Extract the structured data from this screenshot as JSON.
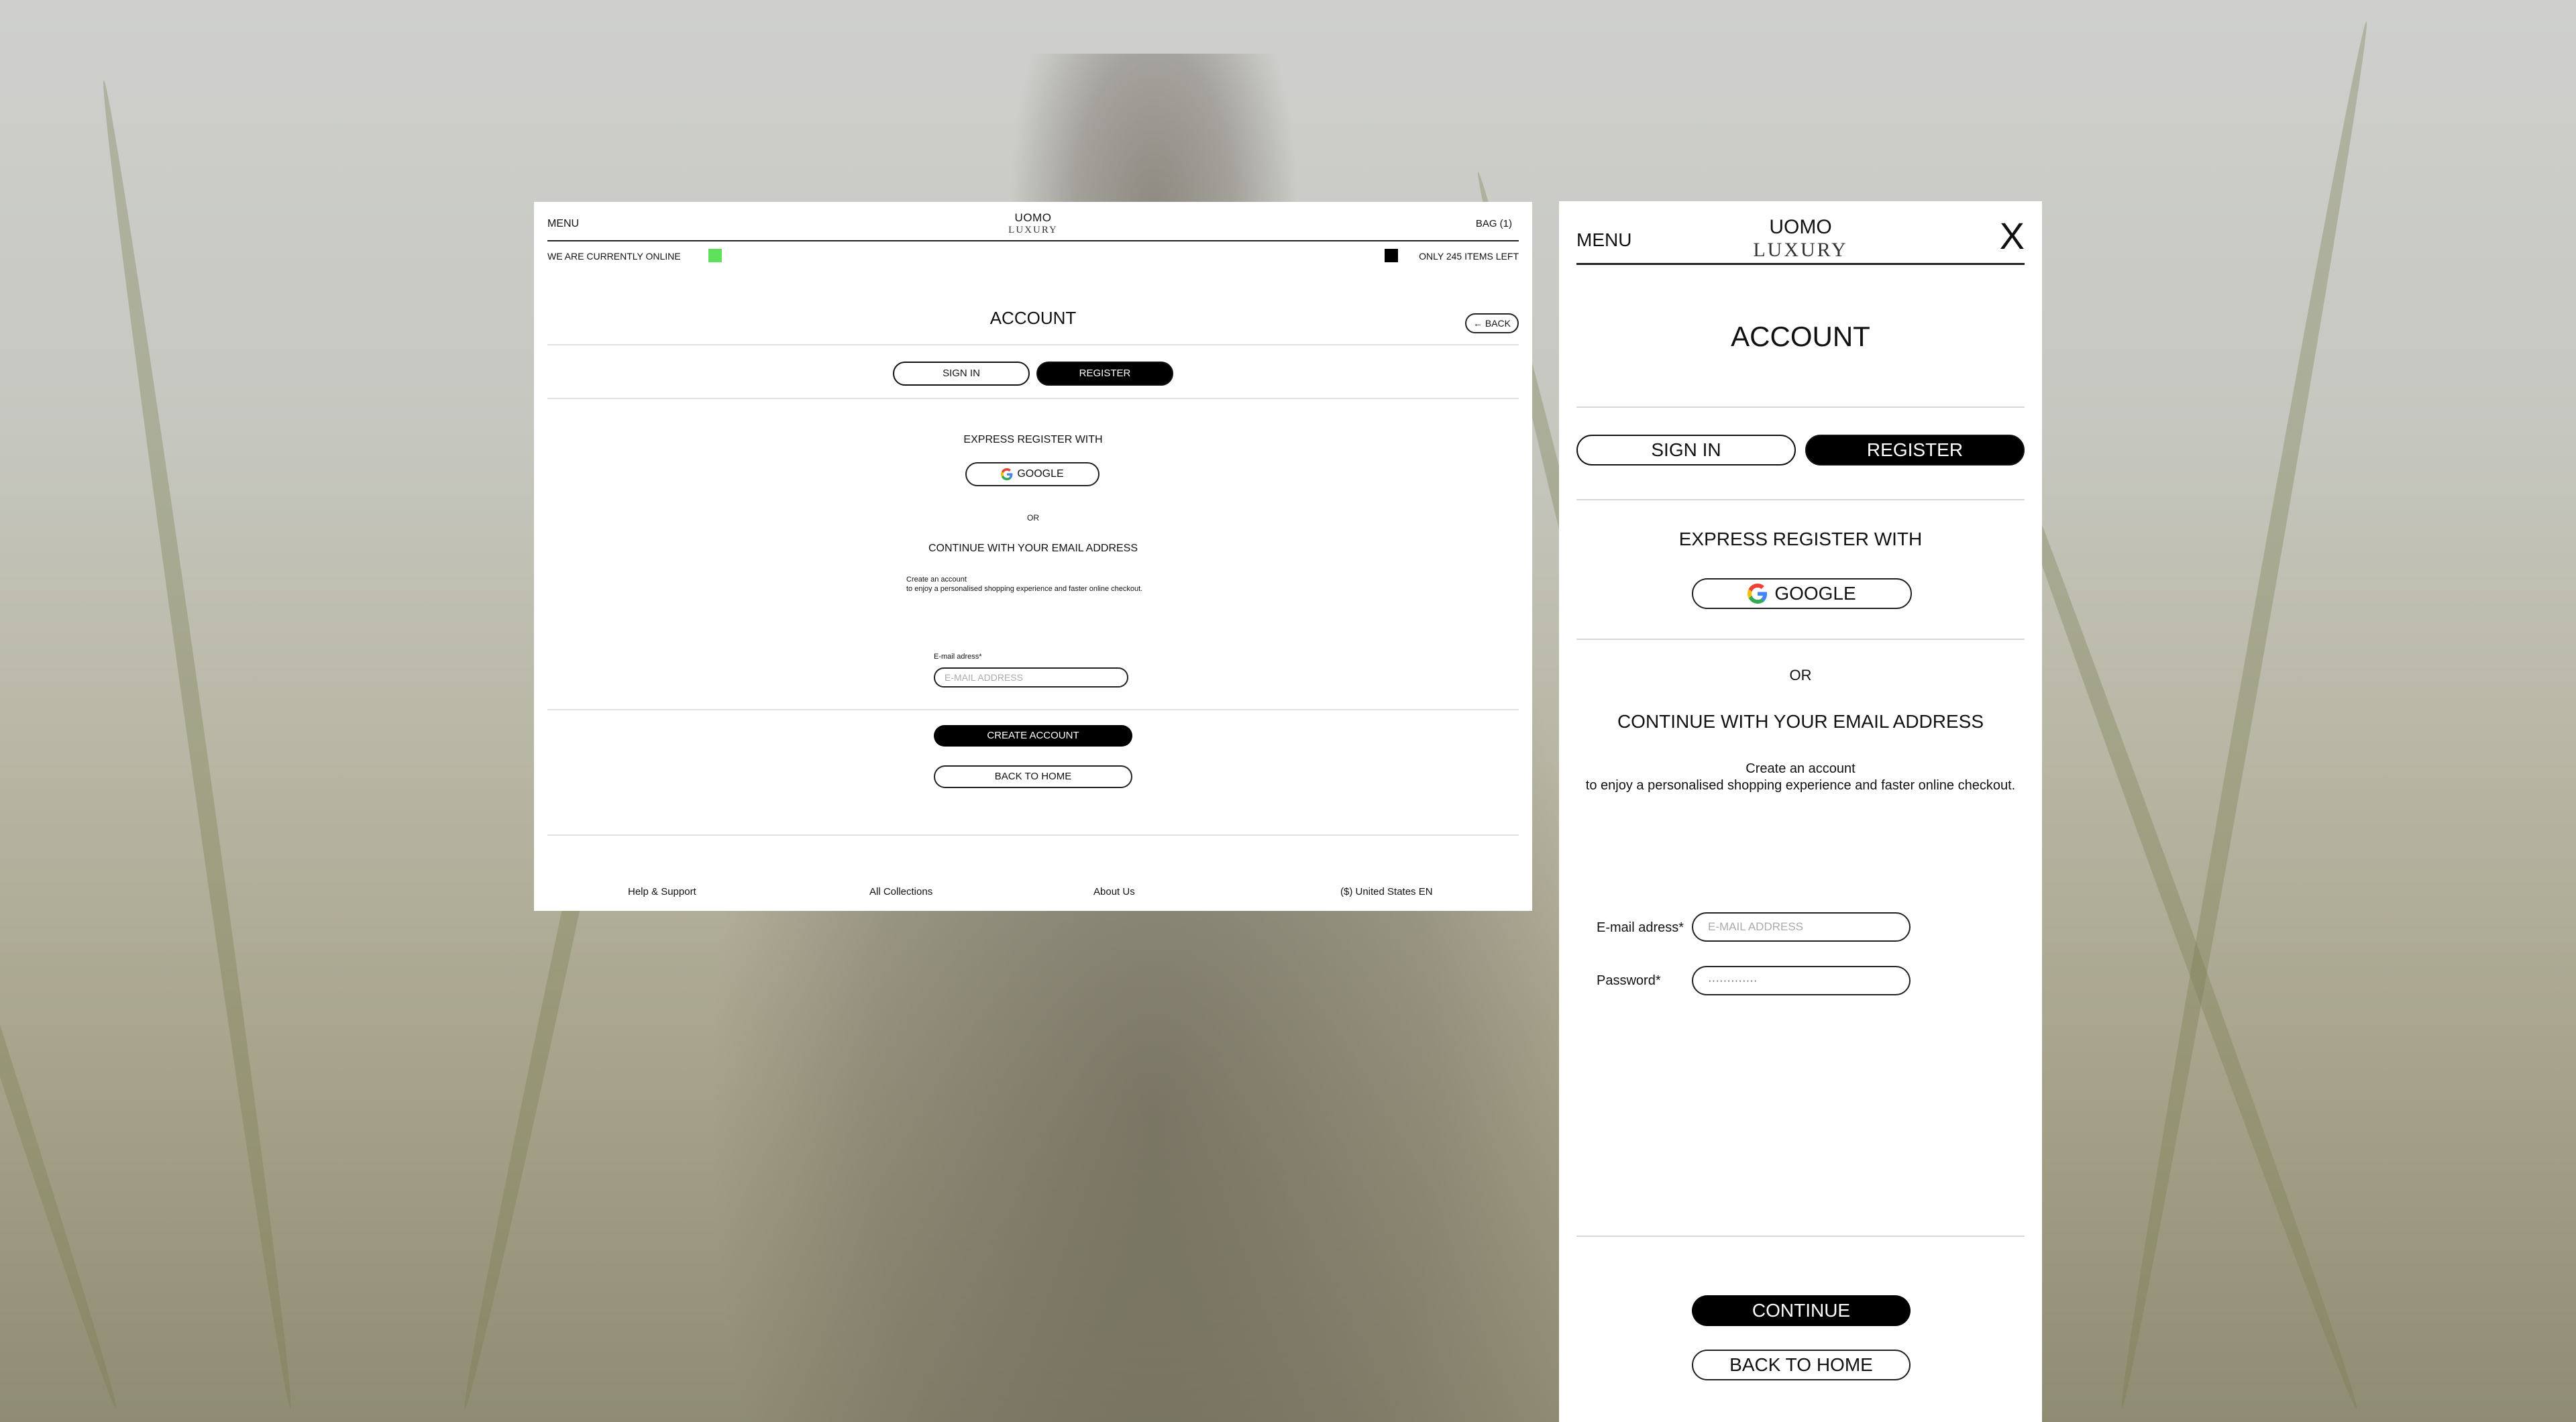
{
  "brand": {
    "line1": "UOMO",
    "line2": "LUXURY"
  },
  "nav": {
    "menu": "MENU",
    "bag": "BAG (1)",
    "close": "X"
  },
  "status": {
    "online": "WE ARE CURRENTLY ONLINE",
    "online_color": "#5ee05a",
    "stock": "ONLY 245 ITEMS LEFT"
  },
  "page": {
    "title": "ACCOUNT",
    "back": "← BACK"
  },
  "tabs": {
    "sign_in": "SIGN IN",
    "register": "REGISTER",
    "active": "REGISTER"
  },
  "express": {
    "heading": "EXPRESS REGISTER WITH",
    "google": "GOOGLE"
  },
  "divider_or": "OR",
  "email_section": {
    "heading": "CONTINUE WITH YOUR EMAIL ADDRESS",
    "line1": "Create an account",
    "line2": "to enjoy a personalised shopping experience and faster online checkout."
  },
  "form": {
    "email_label": "E-mail adress*",
    "email_placeholder": "E-MAIL ADDRESS",
    "password_label": "Password*",
    "password_value": "·············"
  },
  "actions": {
    "create": "CREATE ACCOUNT",
    "continue": "CONTINUE",
    "home": "BACK TO HOME"
  },
  "footer": {
    "help": "Help & Support",
    "collections": "All Collections",
    "about": "About Us",
    "locale": "($) United States EN"
  }
}
